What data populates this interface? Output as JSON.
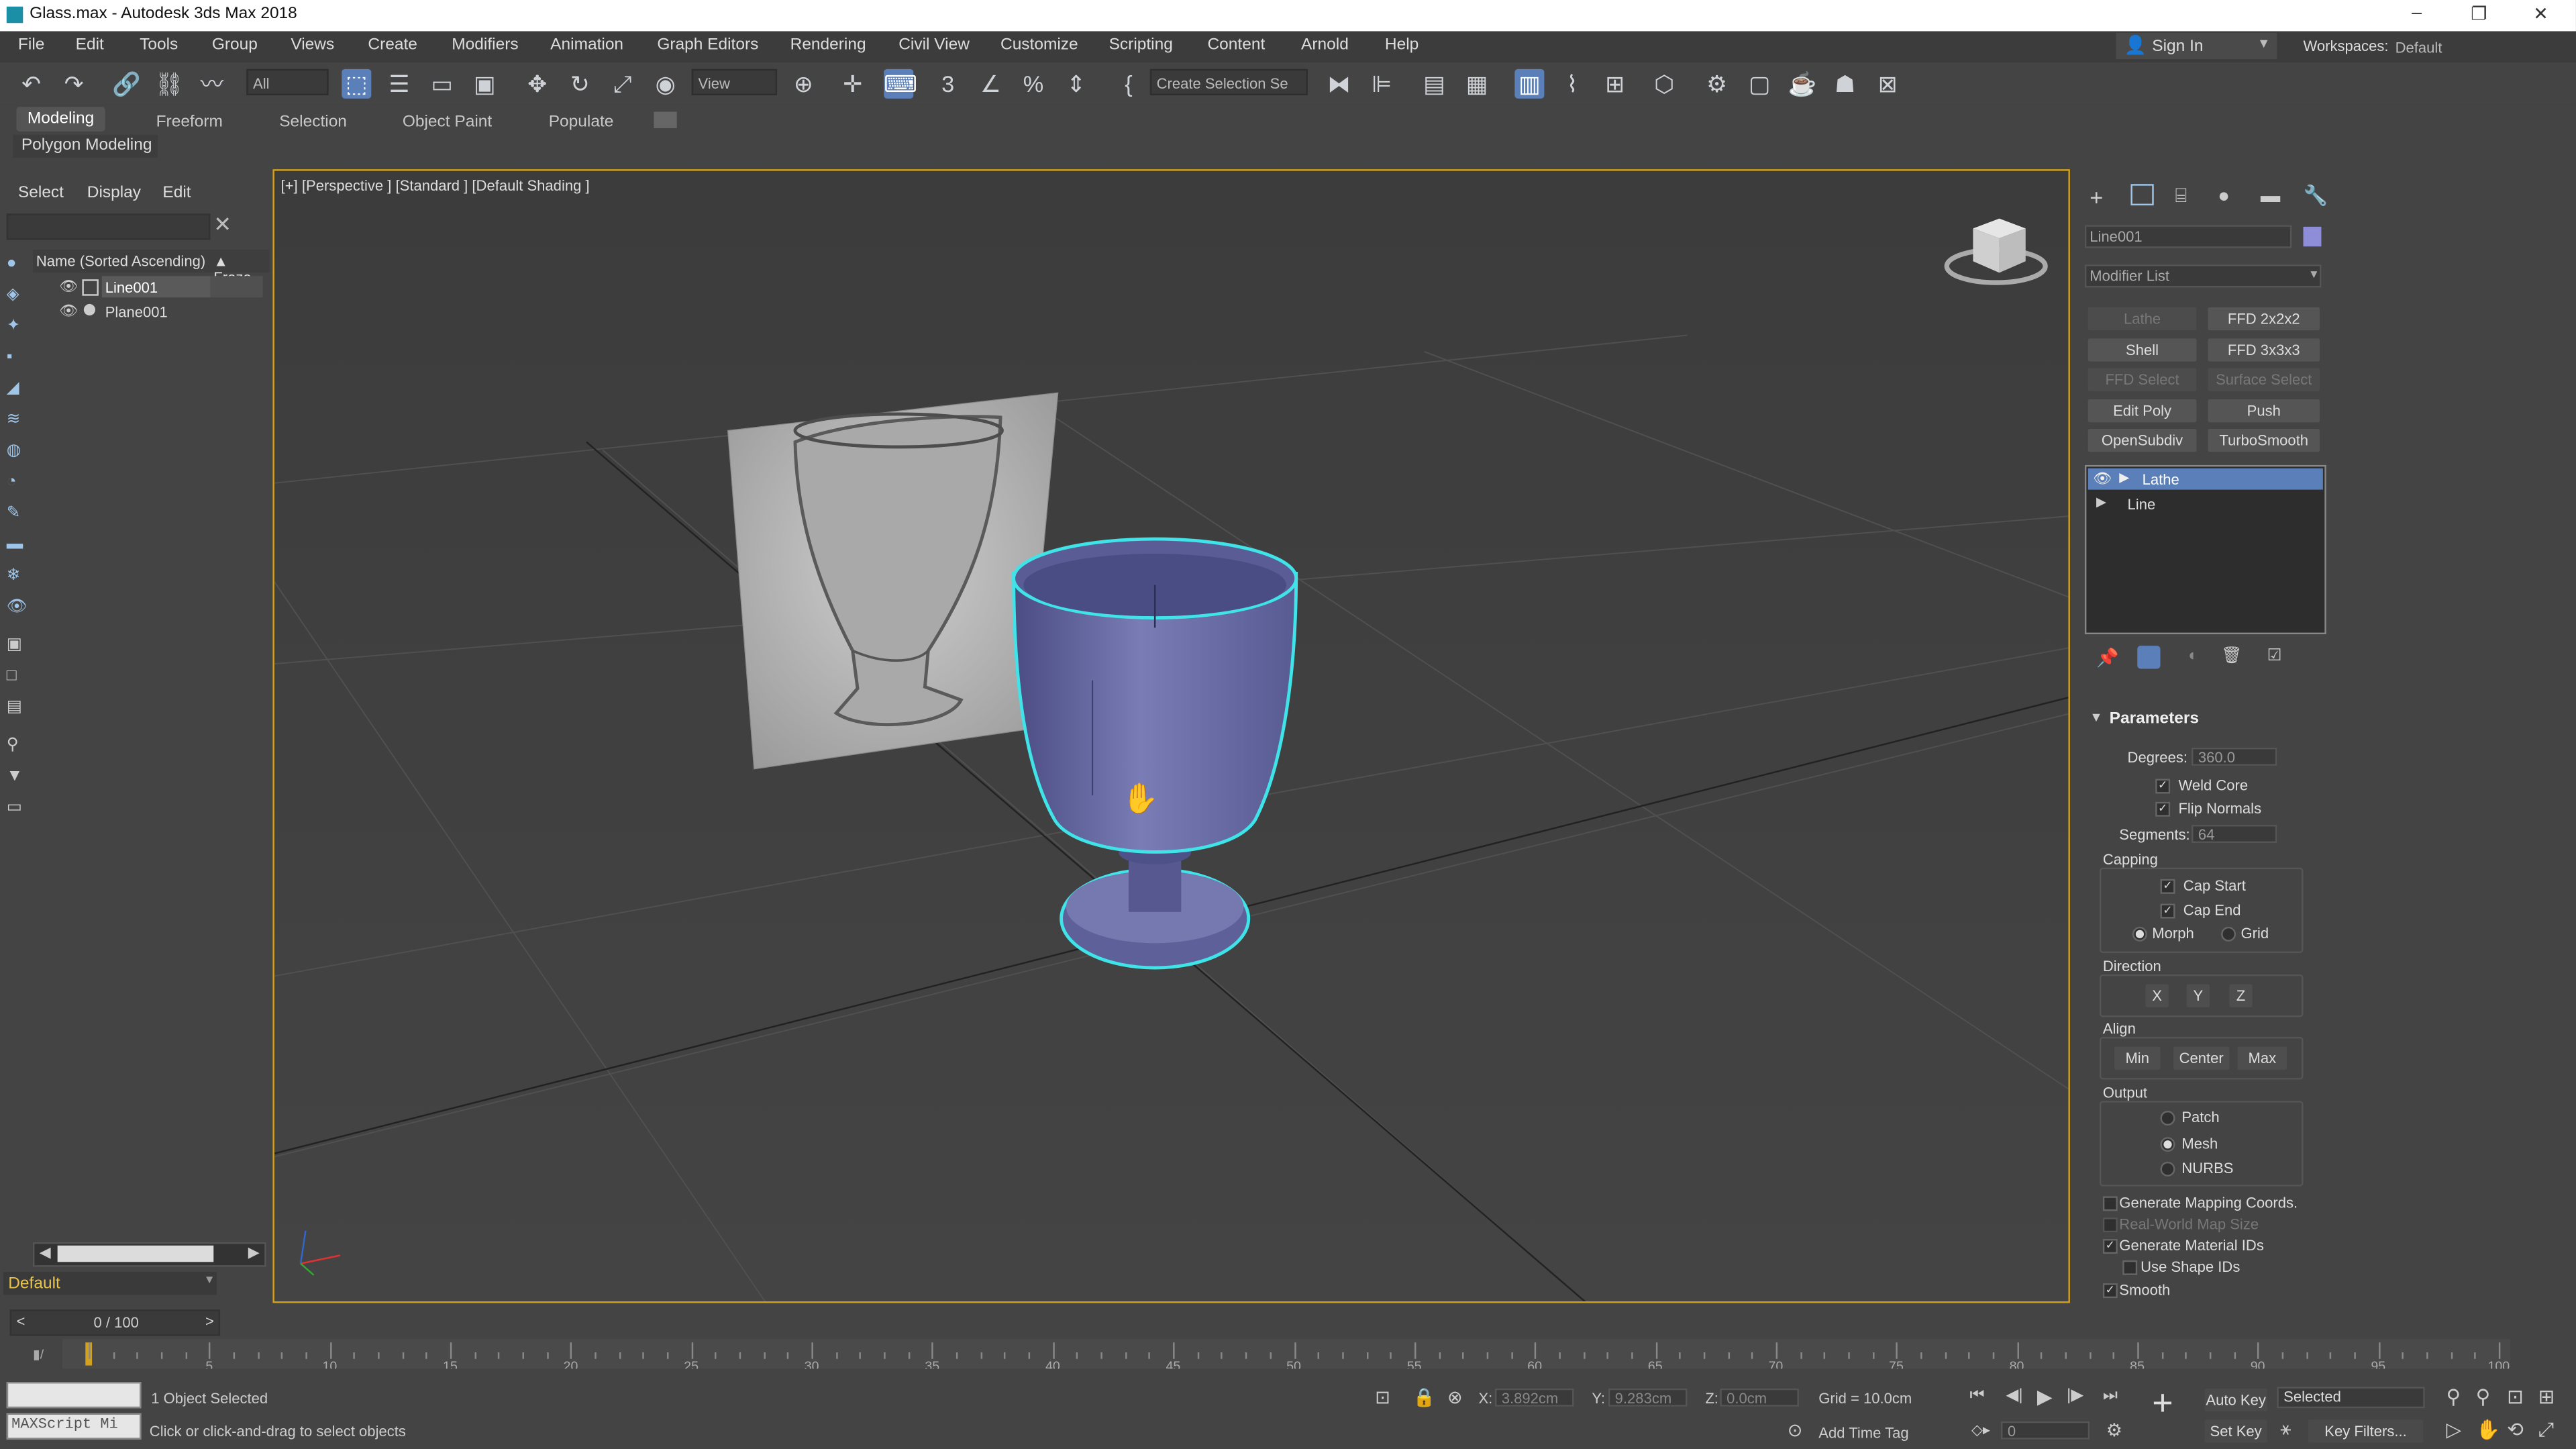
{
  "window": {
    "title": "Glass.max - Autodesk 3ds Max 2018",
    "minimize": "–",
    "restore": "❐",
    "close": "✕"
  },
  "menu": [
    "File",
    "Edit",
    "Tools",
    "Group",
    "Views",
    "Create",
    "Modifiers",
    "Animation",
    "Graph Editors",
    "Rendering",
    "Civil View",
    "Customize",
    "Scripting",
    "Content",
    "Arnold",
    "Help"
  ],
  "account": {
    "signin": "Sign In",
    "workspaces_label": "Workspaces:",
    "workspace": "Default"
  },
  "toolbar": {
    "filter": "All",
    "view": "View",
    "create_selection": "Create Selection Se"
  },
  "ribbon": {
    "tabs": [
      "Modeling",
      "Freeform",
      "Selection",
      "Object Paint",
      "Populate"
    ],
    "active": "Modeling",
    "sub": "Polygon Modeling"
  },
  "explorer": {
    "tabs": [
      "Select",
      "Display",
      "Edit"
    ],
    "column_name": "Name (Sorted Ascending)",
    "column_frozen": "▲ Froze",
    "items": [
      {
        "name": "Line001",
        "selected": true
      },
      {
        "name": "Plane001",
        "selected": false
      }
    ],
    "layer": "Default"
  },
  "viewport": {
    "label": "[+] [Perspective ] [Standard ] [Default Shading ]"
  },
  "command_panel": {
    "object_name": "Line001",
    "modifier_list": "Modifier List",
    "buttons": [
      {
        "label": "Lathe",
        "dim": true
      },
      {
        "label": "FFD 2x2x2",
        "dim": false
      },
      {
        "label": "Shell",
        "dim": false
      },
      {
        "label": "FFD 3x3x3",
        "dim": false
      },
      {
        "label": "FFD Select",
        "dim": true
      },
      {
        "label": "Surface Select",
        "dim": true
      },
      {
        "label": "Edit Poly",
        "dim": false
      },
      {
        "label": "Push",
        "dim": false
      },
      {
        "label": "OpenSubdiv",
        "dim": false
      },
      {
        "label": "TurboSmooth",
        "dim": false
      }
    ],
    "stack": [
      "Lathe",
      "Line"
    ],
    "parameters": {
      "title": "Parameters",
      "degrees_label": "Degrees:",
      "degrees": "360.0",
      "weld_core": "Weld Core",
      "flip_normals": "Flip Normals",
      "segments_label": "Segments:",
      "segments": "64",
      "capping": "Capping",
      "cap_start": "Cap Start",
      "cap_end": "Cap End",
      "morph": "Morph",
      "grid": "Grid",
      "direction": "Direction",
      "x": "X",
      "y": "Y",
      "z": "Z",
      "align": "Align",
      "min": "Min",
      "center": "Center",
      "max": "Max",
      "output": "Output",
      "patch": "Patch",
      "mesh": "Mesh",
      "nurbs": "NURBS",
      "gen_mapping": "Generate Mapping Coords.",
      "real_world": "Real-World Map Size",
      "gen_material": "Generate Material IDs",
      "use_shape": "Use Shape IDs",
      "smooth": "Smooth"
    }
  },
  "timeline": {
    "frame": "0 / 100",
    "ticks": [
      "5",
      "10",
      "15",
      "20",
      "25",
      "30",
      "35",
      "40",
      "45",
      "50",
      "55",
      "60",
      "65",
      "70",
      "75",
      "80",
      "85",
      "90",
      "95",
      "100"
    ]
  },
  "status": {
    "maxscript": "MAXScript Mi",
    "selected": "1 Object Selected",
    "prompt": "Click or click-and-drag to select objects",
    "x_label": "X:",
    "x": "3.892cm",
    "y_label": "Y:",
    "y": "9.283cm",
    "z_label": "Z:",
    "z": "0.0cm",
    "grid": "Grid = 10.0cm",
    "add_time_tag": "Add Time Tag",
    "auto_key": "Auto Key",
    "set_key": "Set Key",
    "selected_dd": "Selected",
    "key_filters": "Key Filters...",
    "frame_field": "0"
  },
  "colors": {
    "accent": "#5b7fb8",
    "selection": "#3fe3e8",
    "viewport_border": "#d4a21a",
    "glass": "#6e70a8"
  }
}
